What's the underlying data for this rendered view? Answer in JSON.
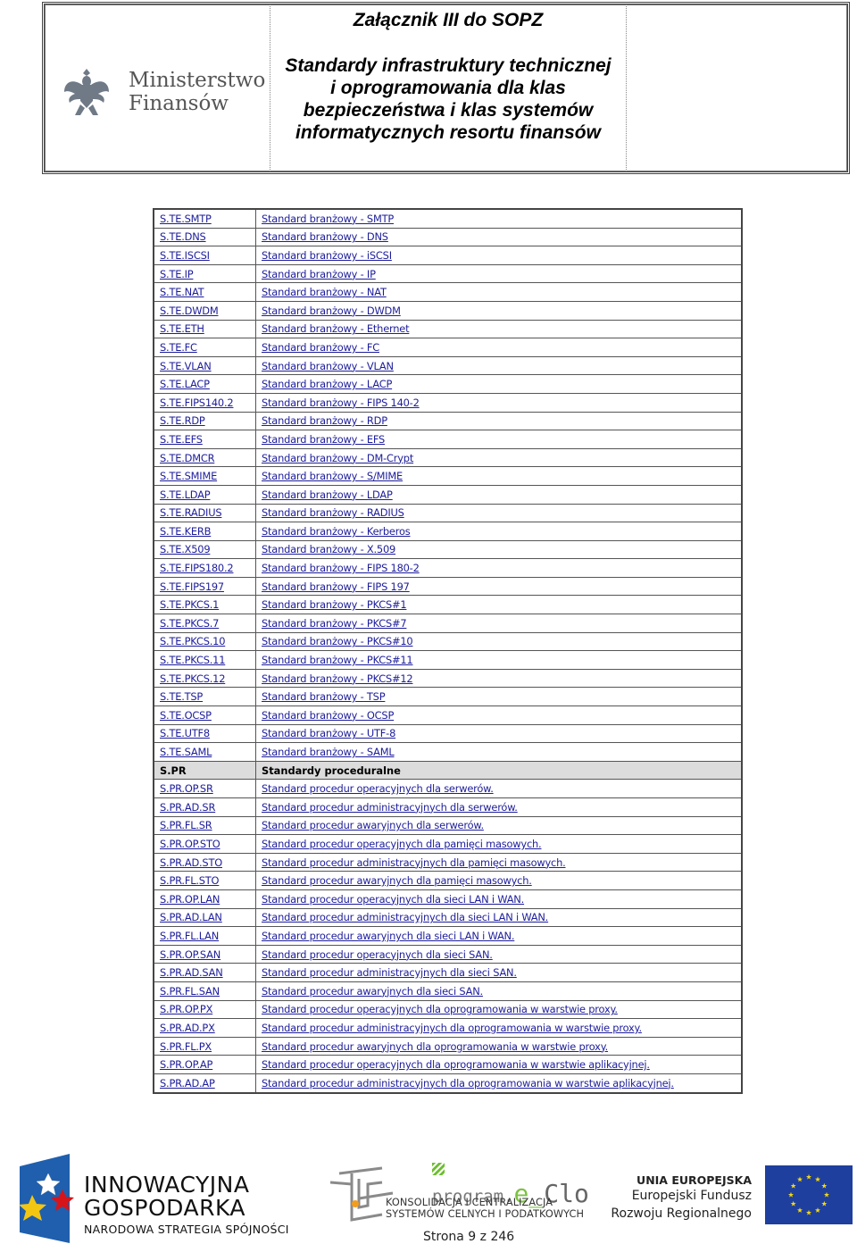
{
  "header": {
    "logo": {
      "line1": "Ministerstwo",
      "line2": "Finansów",
      "emblem": "polish-eagle-emblem"
    },
    "annex": "Załącznik III do SOPZ",
    "title_lines": [
      "Standardy infrastruktury technicznej",
      "i oprogramowania dla klas",
      "bezpieczeństwa i klas systemów",
      "informatycznych resortu finansów"
    ]
  },
  "table": {
    "link_color": "#1d1d9b",
    "section_bg": "#dcdcdc",
    "rows": [
      {
        "code": "S.TE.SMTP",
        "name": "Standard branżowy  - SMTP"
      },
      {
        "code": "S.TE.DNS",
        "name": "Standard branżowy - DNS"
      },
      {
        "code": "S.TE.ISCSI",
        "name": "Standard branżowy - iSCSI"
      },
      {
        "code": "S.TE.IP",
        "name": "Standard branżowy - IP"
      },
      {
        "code": "S.TE.NAT",
        "name": "Standard branżowy - NAT"
      },
      {
        "code": "S.TE.DWDM",
        "name": "Standard branżowy - DWDM"
      },
      {
        "code": "S.TE.ETH",
        "name": "Standard branżowy - Ethernet"
      },
      {
        "code": "S.TE.FC",
        "name": "Standard branżowy - FC"
      },
      {
        "code": "S.TE.VLAN",
        "name": "Standard branżowy - VLAN"
      },
      {
        "code": "S.TE.LACP",
        "name": "Standard branżowy - LACP"
      },
      {
        "code": "S.TE.FIPS140.2",
        "name": "Standard branżowy - FIPS 140-2"
      },
      {
        "code": "S.TE.RDP",
        "name": "Standard branżowy - RDP"
      },
      {
        "code": "S.TE.EFS",
        "name": "Standard branżowy - EFS"
      },
      {
        "code": "S.TE.DMCR",
        "name": "Standard branżowy - DM-Crypt"
      },
      {
        "code": "S.TE.SMIME",
        "name": "Standard branżowy - S/MIME"
      },
      {
        "code": "S.TE.LDAP",
        "name": "Standard branżowy - LDAP"
      },
      {
        "code": "S.TE.RADIUS",
        "name": "Standard branżowy - RADIUS"
      },
      {
        "code": "S.TE.KERB",
        "name": "Standard branżowy - Kerberos"
      },
      {
        "code": "S.TE.X509",
        "name": "Standard branżowy - X.509"
      },
      {
        "code": "S.TE.FIPS180.2",
        "name": "Standard branżowy - FIPS 180-2"
      },
      {
        "code": "S.TE.FIPS197",
        "name": "Standard branżowy - FIPS 197"
      },
      {
        "code": "S.TE.PKCS.1",
        "name": "Standard branżowy - PKCS#1"
      },
      {
        "code": "S.TE.PKCS.7",
        "name": "Standard branżowy - PKCS#7"
      },
      {
        "code": "S.TE.PKCS.10",
        "name": "Standard branżowy - PKCS#10"
      },
      {
        "code": "S.TE.PKCS.11",
        "name": "Standard branżowy - PKCS#11"
      },
      {
        "code": "S.TE.PKCS.12",
        "name": "Standard branżowy - PKCS#12"
      },
      {
        "code": "S.TE.TSP",
        "name": "Standard branżowy - TSP"
      },
      {
        "code": "S.TE.OCSP",
        "name": "Standard branżowy - OCSP"
      },
      {
        "code": "S.TE.UTF8",
        "name": "Standard branżowy - UTF-8"
      },
      {
        "code": "S.TE.SAML",
        "name": "Standard branżowy - SAML"
      },
      {
        "code": "S.PR",
        "name": "Standardy proceduralne",
        "section": true
      },
      {
        "code": "S.PR.OP.SR",
        "name": "Standard procedur operacyjnych dla serwerów."
      },
      {
        "code": "S.PR.AD.SR",
        "name": "Standard procedur administracyjnych dla serwerów."
      },
      {
        "code": "S.PR.FL.SR",
        "name": "Standard procedur awaryjnych dla serwerów."
      },
      {
        "code": "S.PR.OP.STO",
        "name": "Standard procedur operacyjnych dla pamięci masowych."
      },
      {
        "code": "S.PR.AD.STO",
        "name": "Standard procedur administracyjnych dla pamięci masowych."
      },
      {
        "code": "S.PR.FL.STO",
        "name": "Standard procedur awaryjnych dla pamięci masowych."
      },
      {
        "code": "S.PR.OP.LAN",
        "name": "Standard procedur operacyjnych dla sieci LAN i WAN."
      },
      {
        "code": "S.PR.AD.LAN",
        "name": "Standard procedur administracyjnych dla sieci LAN i WAN."
      },
      {
        "code": "S.PR.FL.LAN",
        "name": "Standard procedur awaryjnych dla sieci LAN i WAN."
      },
      {
        "code": "S.PR.OP.SAN",
        "name": "Standard procedur operacyjnych dla sieci SAN."
      },
      {
        "code": "S.PR.AD.SAN",
        "name": "Standard procedur administracyjnych dla sieci SAN."
      },
      {
        "code": "S.PR.FL.SAN",
        "name": "Standard procedur awaryjnych dla sieci SAN."
      },
      {
        "code": "S.PR.OP.PX",
        "name": "Standard procedur operacyjnych dla oprogramowania w warstwie proxy."
      },
      {
        "code": "S.PR.AD.PX",
        "name": "Standard procedur administracyjnych dla oprogramowania w warstwie proxy."
      },
      {
        "code": "S.PR.FL.PX",
        "name": "Standard procedur awaryjnych dla oprogramowania w warstwie proxy."
      },
      {
        "code": "S.PR.OP.AP",
        "name": "Standard procedur operacyjnych dla oprogramowania w warstwie aplikacyjnej."
      },
      {
        "code": "S.PR.AD.AP",
        "name": "Standard procedur administracyjnych dla oprogramowania w warstwie aplikacyjnej."
      }
    ]
  },
  "footer": {
    "innowacyjna": {
      "line1": "INNOWACYJNA",
      "line2": "GOSPODARKA",
      "line3": "NARODOWA STRATEGIA SPÓJNOŚCI"
    },
    "eclo": {
      "program": "program.",
      "e": "e",
      "underscore": "_",
      "clo": "Clo",
      "line1": "KONSOLIDACJA I CENTRALIZACJA",
      "line2": "SYSTEMÓW CELNYCH I PODATKOWYCH"
    },
    "page_number": "Strona 9 z 246",
    "eu": {
      "line1": "UNIA EUROPEJSKA",
      "line2": "Europejski Fundusz",
      "line3": "Rozwoju Regionalnego"
    },
    "colors": {
      "eu_blue": "#1f3f9e",
      "eu_star": "#f5d90a",
      "eclo_green": "#7cc242"
    }
  }
}
